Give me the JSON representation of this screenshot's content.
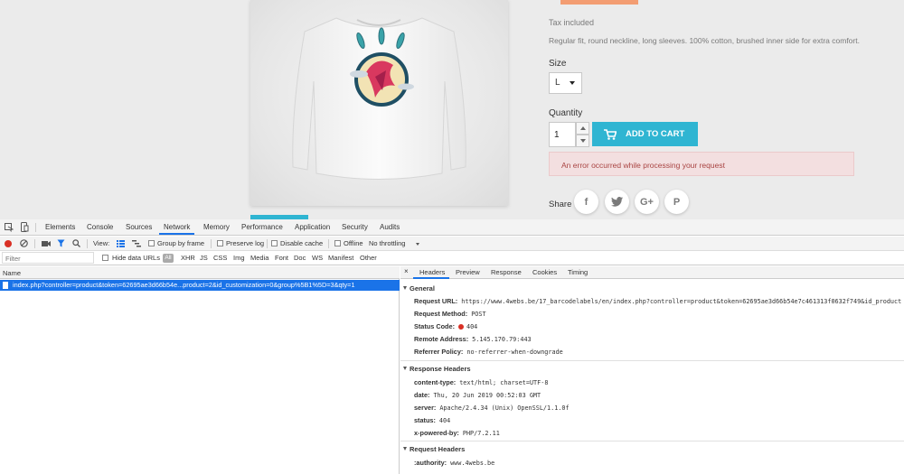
{
  "store": {
    "tax": "Tax included",
    "description": "Regular fit, round neckline, long sleeves. 100% cotton, brushed inner side for extra comfort.",
    "size_label": "Size",
    "size_value": "L",
    "quantity_label": "Quantity",
    "quantity_value": "1",
    "add_to_cart": "ADD TO CART",
    "error": "An error occurred while processing your request",
    "share_label": "Share",
    "social": [
      "f",
      "twitter",
      "G+",
      "P"
    ]
  },
  "devtools": {
    "tabs": [
      "Elements",
      "Console",
      "Sources",
      "Network",
      "Memory",
      "Performance",
      "Application",
      "Security",
      "Audits"
    ],
    "active_tab": "Network",
    "toolbar": {
      "view_label": "View:",
      "group_by_frame": "Group by frame",
      "preserve_log": "Preserve log",
      "disable_cache": "Disable cache",
      "offline": "Offline",
      "throttling": "No throttling"
    },
    "filter": {
      "placeholder": "Filter",
      "hide_data_urls": "Hide data URLs",
      "all": "All",
      "types": [
        "XHR",
        "JS",
        "CSS",
        "Img",
        "Media",
        "Font",
        "Doc",
        "WS",
        "Manifest",
        "Other"
      ]
    },
    "name_header": "Name",
    "request_name": "index.php?controller=product&token=62695ae3d66b54e...product=2&id_customization=0&group%5B1%5D=3&qty=1",
    "detail_tabs": [
      "Headers",
      "Preview",
      "Response",
      "Cookies",
      "Timing"
    ],
    "general": {
      "title": "General",
      "request_url_k": "Request URL:",
      "request_url_v": "https://www.4webs.be/17_barcodelabels/en/index.php?controller=product&token=62695ae3d66b54e7c461313f0632f749&id_product",
      "request_method_k": "Request Method:",
      "request_method_v": "POST",
      "status_code_k": "Status Code:",
      "status_code_v": "404",
      "remote_address_k": "Remote Address:",
      "remote_address_v": "5.145.170.79:443",
      "referrer_policy_k": "Referrer Policy:",
      "referrer_policy_v": "no-referrer-when-downgrade"
    },
    "response_headers": {
      "title": "Response Headers",
      "content_type_k": "content-type:",
      "content_type_v": "text/html; charset=UTF-8",
      "date_k": "date:",
      "date_v": "Thu, 20 Jun 2019 00:52:03 GMT",
      "server_k": "server:",
      "server_v": "Apache/2.4.34 (Unix) OpenSSL/1.1.0f",
      "status_k": "status:",
      "status_v": "404",
      "x_powered_by_k": "x-powered-by:",
      "x_powered_by_v": "PHP/7.2.11"
    },
    "request_headers": {
      "title": "Request Headers",
      "authority_k": ":authority:",
      "authority_v": "www.4webs.be"
    }
  }
}
